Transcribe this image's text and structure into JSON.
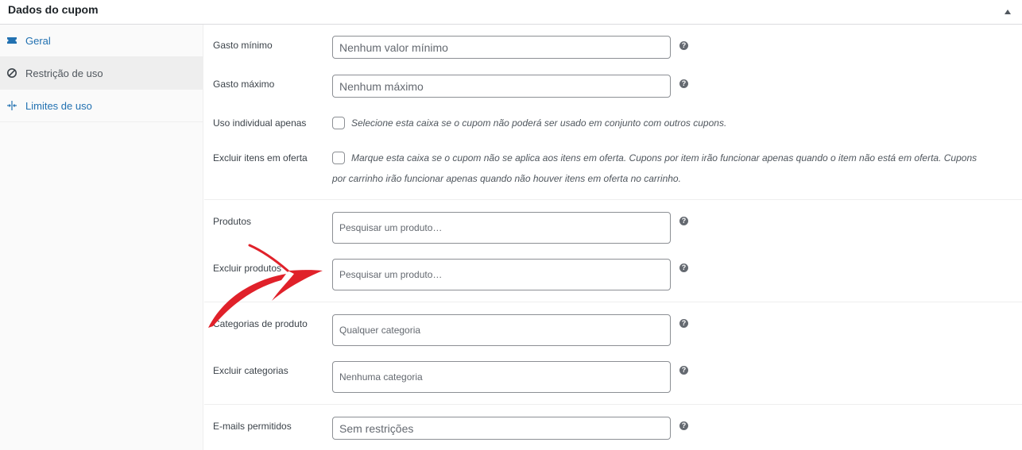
{
  "panel": {
    "title": "Dados do cupom"
  },
  "tabs": [
    {
      "label": "Geral",
      "icon": "ticket-icon"
    },
    {
      "label": "Restrição de uso",
      "icon": "no-entry-icon"
    },
    {
      "label": "Limites de uso",
      "icon": "limits-icon"
    }
  ],
  "fields": {
    "minimum_spend": {
      "label": "Gasto mínimo",
      "placeholder": "Nenhum valor mínimo"
    },
    "maximum_spend": {
      "label": "Gasto máximo",
      "placeholder": "Nenhum máximo"
    },
    "individual_use": {
      "label": "Uso individual apenas",
      "description": "Selecione esta caixa se o cupom não poderá ser usado em conjunto com outros cupons."
    },
    "exclude_sale_items": {
      "label": "Excluir itens em oferta",
      "description_line1": "Marque esta caixa se o cupom não se aplica aos itens em oferta. Cupons por item irão funcionar apenas quando o item não está em oferta. Cupons",
      "description_line2": "por carrinho irão funcionar apenas quando não houver itens em oferta no carrinho."
    },
    "products": {
      "label": "Produtos",
      "placeholder": "Pesquisar um produto…"
    },
    "exclude_products": {
      "label": "Excluir produtos",
      "placeholder": "Pesquisar um produto…"
    },
    "product_categories": {
      "label": "Categorias de produto",
      "placeholder": "Qualquer categoria"
    },
    "exclude_categories": {
      "label": "Excluir categorias",
      "placeholder": "Nenhuma categoria"
    },
    "allowed_emails": {
      "label": "E-mails permitidos",
      "placeholder": "Sem restrições"
    }
  },
  "help_glyph": "?",
  "colors": {
    "link": "#2271b1",
    "annotation_arrow": "#e0212a"
  }
}
